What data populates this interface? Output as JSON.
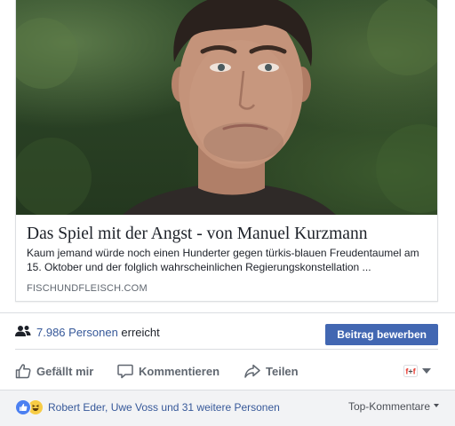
{
  "link_preview": {
    "title": "Das Spiel mit der Angst - von Manuel Kurzmann",
    "description": "Kaum jemand würde noch einen Hunderter gegen türkis-blauen Freudentaumel am 15. Oktober und der folglich wahrscheinlichen Regierungskonstellation ...",
    "domain": "FISCHUNDFLEISCH.COM"
  },
  "reach": {
    "count": "7.986 Personen",
    "suffix": "erreicht",
    "boost_label": "Beitrag bewerben"
  },
  "actions": {
    "like_label": "Gefällt mir",
    "comment_label": "Kommentieren",
    "share_label": "Teilen"
  },
  "reactions": {
    "people": "Robert Eder, Uwe Voss und 31 weitere Personen",
    "sort_label": "Top-Kommentare"
  },
  "colors": {
    "link": "#365899",
    "boost_button": "#4267b2",
    "like_reaction": "#4c80f1",
    "haha_reaction": "#f7cc45"
  }
}
